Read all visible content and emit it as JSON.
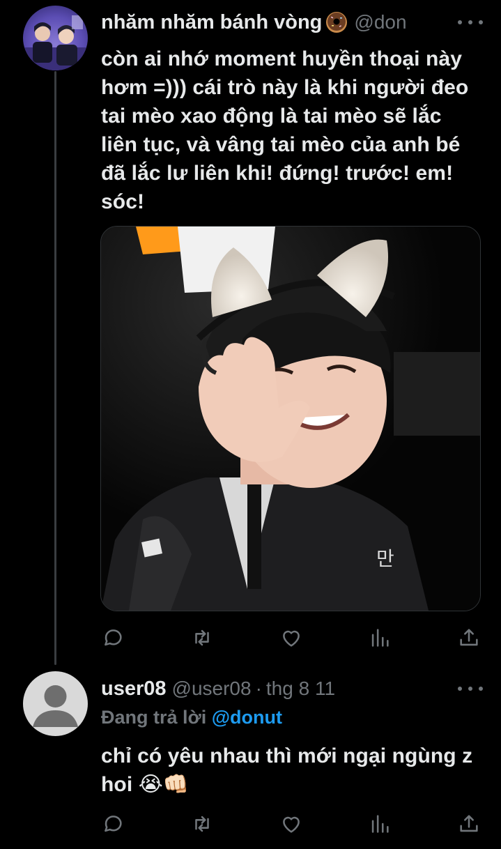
{
  "post": {
    "author_name": "nhăm nhăm bánh vòng",
    "author_handle": "@don",
    "text": "còn ai nhớ moment huyền thoại này\nhơm =))) cái trò này là khi người đeo\ntai mèo xao động là tai mèo sẽ lắc\nliên tục, và vâng tai mèo của anh bé\nđã lắc lư liên khi! đứng! trước! em!\nsóc!",
    "media_jersey_text": "만"
  },
  "reply": {
    "author_name": "user08",
    "author_handle": "@user08",
    "separator": "·",
    "date": "thg 8 11",
    "replying_label": "Đang trả lời",
    "replying_handle": "@donut",
    "text": "chỉ có yêu nhau thì mới ngại ngùng z\nhoi 😭👊🏻"
  },
  "colors": {
    "background": "#000000",
    "text": "#e7e9ea",
    "muted": "#71767b",
    "accent": "#1d9bf0"
  },
  "icons": [
    "reply-icon",
    "retweet-icon",
    "like-icon",
    "views-icon",
    "share-icon",
    "more-icon",
    "donut-emoji"
  ]
}
